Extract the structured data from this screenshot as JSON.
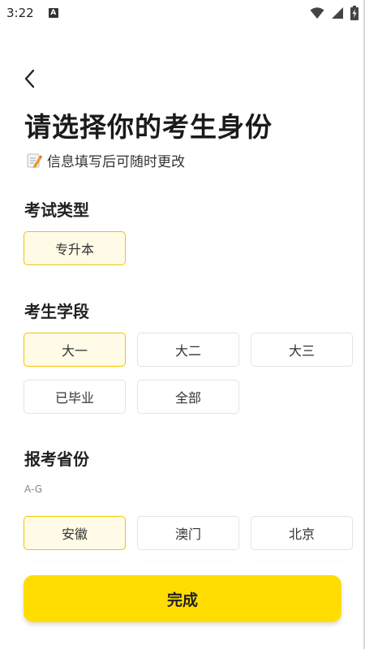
{
  "status_bar": {
    "time": "3:22",
    "notification_badge": "A",
    "icons": [
      "wifi-icon",
      "signal-icon",
      "battery-charging-icon"
    ]
  },
  "header": {
    "back_icon": "chevron-left-icon",
    "title": "请选择你的考生身份",
    "subtitle_icon": "memo-icon",
    "subtitle": "信息填写后可随时更改"
  },
  "exam_type": {
    "label": "考试类型",
    "options": [
      {
        "label": "专升本",
        "selected": true
      }
    ]
  },
  "grade": {
    "label": "考生学段",
    "options": [
      {
        "label": "大一",
        "selected": true
      },
      {
        "label": "大二",
        "selected": false
      },
      {
        "label": "大三",
        "selected": false
      },
      {
        "label": "已毕业",
        "selected": false
      },
      {
        "label": "全部",
        "selected": false
      }
    ]
  },
  "province": {
    "label": "报考省份",
    "group_hint": "A-G",
    "options": [
      {
        "label": "安徽",
        "selected": true
      },
      {
        "label": "澳门",
        "selected": false
      },
      {
        "label": "北京",
        "selected": false
      }
    ]
  },
  "footer": {
    "done_label": "完成"
  },
  "colors": {
    "accent": "#ffdd00",
    "selected_bg": "#fffbe6",
    "selected_border": "#f2c400"
  }
}
